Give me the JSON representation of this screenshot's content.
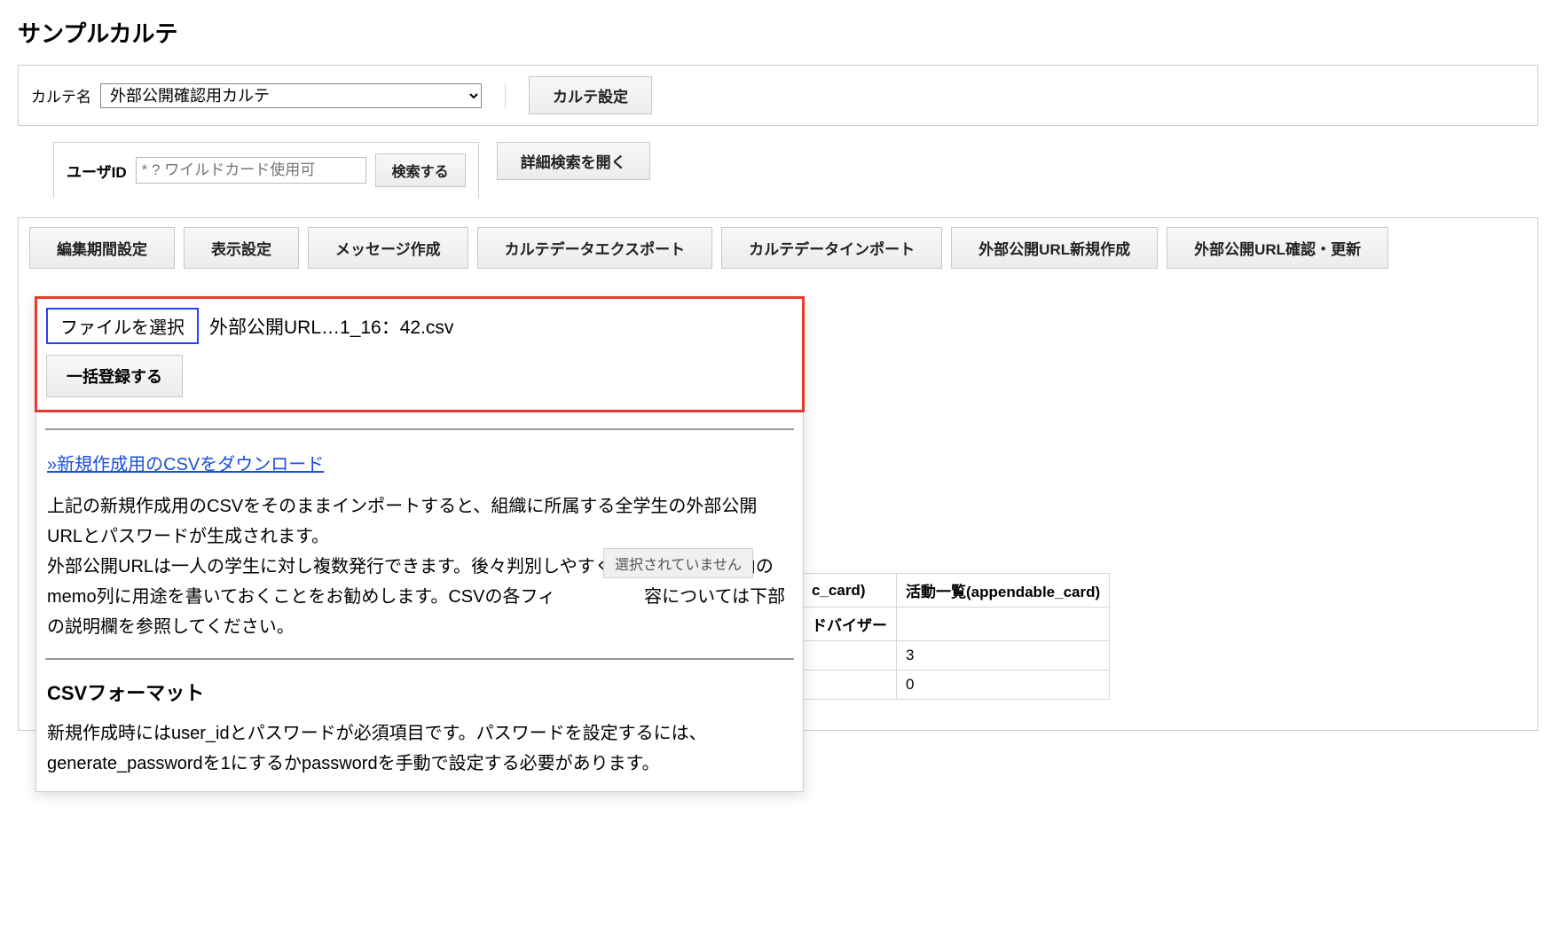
{
  "page": {
    "title": "サンプルカルテ"
  },
  "selector": {
    "label": "カルテ名",
    "value": "外部公開確認用カルテ",
    "settings_btn": "カルテ設定"
  },
  "search": {
    "label": "ユーザID",
    "placeholder": "* ? ワイルドカード使用可",
    "search_btn": "検索する",
    "advanced_btn": "詳細検索を開く"
  },
  "tabs": {
    "edit_period": "編集期間設定",
    "display_settings": "表示設定",
    "message_create": "メッセージ作成",
    "export": "カルテデータエクスポート",
    "import": "カルテデータインポート",
    "ext_url_new": "外部公開URL新規作成",
    "ext_url_confirm": "外部公開URL確認・更新"
  },
  "popover": {
    "file_select_btn": "ファイルを選択",
    "file_name": "外部公開URL…1_16：42.csv",
    "register_btn": "一括登録する",
    "csv_download_link": "»新規作成用のCSVをダウンロード",
    "para1": "上記の新規作成用のCSVをそのままインポートすると、組織に所属する全学生の外部公開URLとパスワードが生成されます。",
    "para2": "外部公開URLは一人の学生に対し複数発行できます。後々判別しやすくするため、CSV内のmemo列に用途を書いておくことをお勧めします。CSVの各フィ　　　　　容については下部の説明欄を参照してください。",
    "csv_format_heading": "CSVフォーマット",
    "para3": "新規作成時にはuser_idとパスワードが必須項目です。パスワードを設定するには、generate_passwordを1にするかpasswordを手動で設定する必要があります。",
    "tooltip": "選択されていません"
  },
  "bg_table": {
    "col1": "c_card)",
    "col2": "活動一覧(appendable_card)",
    "row_header": "ドバイザー",
    "val1": "3",
    "val2": "0"
  }
}
